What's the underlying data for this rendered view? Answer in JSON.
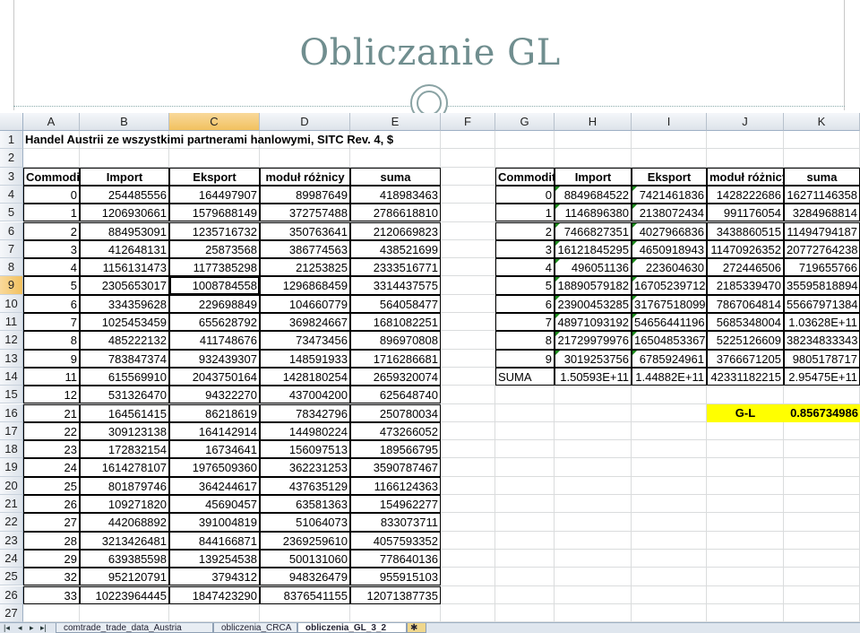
{
  "slide": {
    "title": "Obliczanie GL"
  },
  "sheet": {
    "columns": [
      "A",
      "B",
      "C",
      "D",
      "E",
      "F",
      "G",
      "H",
      "I",
      "J",
      "K"
    ],
    "selected_column": "C",
    "selected_row": 9,
    "rows": [
      1,
      2,
      3,
      4,
      5,
      6,
      7,
      8,
      9,
      10,
      11,
      12,
      13,
      14,
      15,
      16,
      17,
      18,
      19,
      20,
      21,
      22,
      23,
      24,
      25,
      26,
      27
    ],
    "row1_text": "Handel Austrii ze wszystkimi partnerami hanlowymi, SITC Rev. 4, $",
    "left_table": {
      "headers": [
        "Commodit",
        "Import",
        "Eksport",
        "moduł różnicy",
        "suma"
      ],
      "rows": [
        [
          "0",
          "254485556",
          "164497907",
          "89987649",
          "418983463"
        ],
        [
          "1",
          "1206930661",
          "1579688149",
          "372757488",
          "2786618810"
        ],
        [
          "2",
          "884953091",
          "1235716732",
          "350763641",
          "2120669823"
        ],
        [
          "3",
          "412648131",
          "25873568",
          "386774563",
          "438521699"
        ],
        [
          "4",
          "1156131473",
          "1177385298",
          "21253825",
          "2333516771"
        ],
        [
          "5",
          "2305653017",
          "1008784558",
          "1296868459",
          "3314437575"
        ],
        [
          "6",
          "334359628",
          "229698849",
          "104660779",
          "564058477"
        ],
        [
          "7",
          "1025453459",
          "655628792",
          "369824667",
          "1681082251"
        ],
        [
          "8",
          "485222132",
          "411748676",
          "73473456",
          "896970808"
        ],
        [
          "9",
          "783847374",
          "932439307",
          "148591933",
          "1716286681"
        ],
        [
          "11",
          "615569910",
          "2043750164",
          "1428180254",
          "2659320074"
        ],
        [
          "12",
          "531326470",
          "94322270",
          "437004200",
          "625648740"
        ],
        [
          "21",
          "164561415",
          "86218619",
          "78342796",
          "250780034"
        ],
        [
          "22",
          "309123138",
          "164142914",
          "144980224",
          "473266052"
        ],
        [
          "23",
          "172832154",
          "16734641",
          "156097513",
          "189566795"
        ],
        [
          "24",
          "1614278107",
          "1976509360",
          "362231253",
          "3590787467"
        ],
        [
          "25",
          "801879746",
          "364244617",
          "437635129",
          "1166124363"
        ],
        [
          "26",
          "109271820",
          "45690457",
          "63581363",
          "154962277"
        ],
        [
          "27",
          "442068892",
          "391004819",
          "51064073",
          "833073711"
        ],
        [
          "28",
          "3213426481",
          "844166871",
          "2369259610",
          "4057593352"
        ],
        [
          "29",
          "639385598",
          "139254538",
          "500131060",
          "778640136"
        ],
        [
          "32",
          "952120791",
          "3794312",
          "948326479",
          "955915103"
        ],
        [
          "33",
          "10223964445",
          "1847423290",
          "8376541155",
          "12071387735"
        ]
      ]
    },
    "right_table": {
      "headers": [
        "Commodit",
        "Import",
        "Eksport",
        "moduł różnicy",
        "suma"
      ],
      "rows": [
        [
          "0",
          "8849684522",
          "7421461836",
          "1428222686",
          "16271146358"
        ],
        [
          "1",
          "1146896380",
          "2138072434",
          "991176054",
          "3284968814"
        ],
        [
          "2",
          "7466827351",
          "4027966836",
          "3438860515",
          "11494794187"
        ],
        [
          "3",
          "16121845295",
          "4650918943",
          "11470926352",
          "20772764238"
        ],
        [
          "4",
          "496051136",
          "223604630",
          "272446506",
          "719655766"
        ],
        [
          "5",
          "18890579182",
          "16705239712",
          "2185339470",
          "35595818894"
        ],
        [
          "6",
          "23900453285",
          "31767518099",
          "7867064814",
          "55667971384"
        ],
        [
          "7",
          "48971093192",
          "54656441196",
          "5685348004",
          "1.03628E+11"
        ],
        [
          "8",
          "21729979976",
          "16504853367",
          "5225126609",
          "38234833343"
        ],
        [
          "9",
          "3019253756",
          "6785924961",
          "3766671205",
          "9805178717"
        ]
      ],
      "suma_row": [
        "SUMA",
        "1.50593E+11",
        "1.44882E+11",
        "42331182215",
        "2.95475E+11"
      ],
      "gl_label": "G-L",
      "gl_value": "0.856734986"
    },
    "tabs": [
      "comtrade_trade_data_Austria",
      "obliczenia_CRCA",
      "obliczenia_GL_3_2"
    ],
    "active_tab": "obliczenia_GL_3_2",
    "nav_icons": [
      "first-sheet-icon",
      "prev-sheet-icon",
      "next-sheet-icon",
      "last-sheet-icon"
    ]
  },
  "colors": {
    "title": "#708e8f",
    "highlight": "#ffff00",
    "selected_header": "#f1c15f"
  }
}
